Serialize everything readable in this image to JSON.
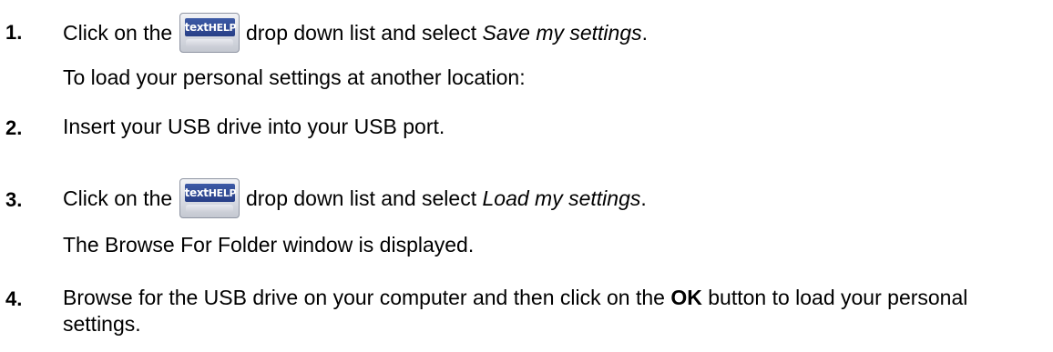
{
  "logo": {
    "text_lower": "text",
    "text_upper": "HELP"
  },
  "steps": [
    {
      "number": "1.",
      "before": "Click on the",
      "after": "drop down list and select",
      "emphasis": "Save my settings",
      "end": "."
    },
    {
      "number": "2.",
      "text": "Insert your USB drive into your USB port."
    },
    {
      "number": "3.",
      "before": "Click on the",
      "after": "drop down list and select",
      "emphasis": "Load my settings",
      "end": "."
    },
    {
      "number": "4.",
      "text_before": "Browse for the USB drive on your computer and then click on the",
      "bold": "OK",
      "text_after": "button to load your personal settings."
    }
  ],
  "notes": {
    "after_step1": "To load your personal settings at another location:",
    "after_step3": "The Browse For Folder window is displayed."
  }
}
